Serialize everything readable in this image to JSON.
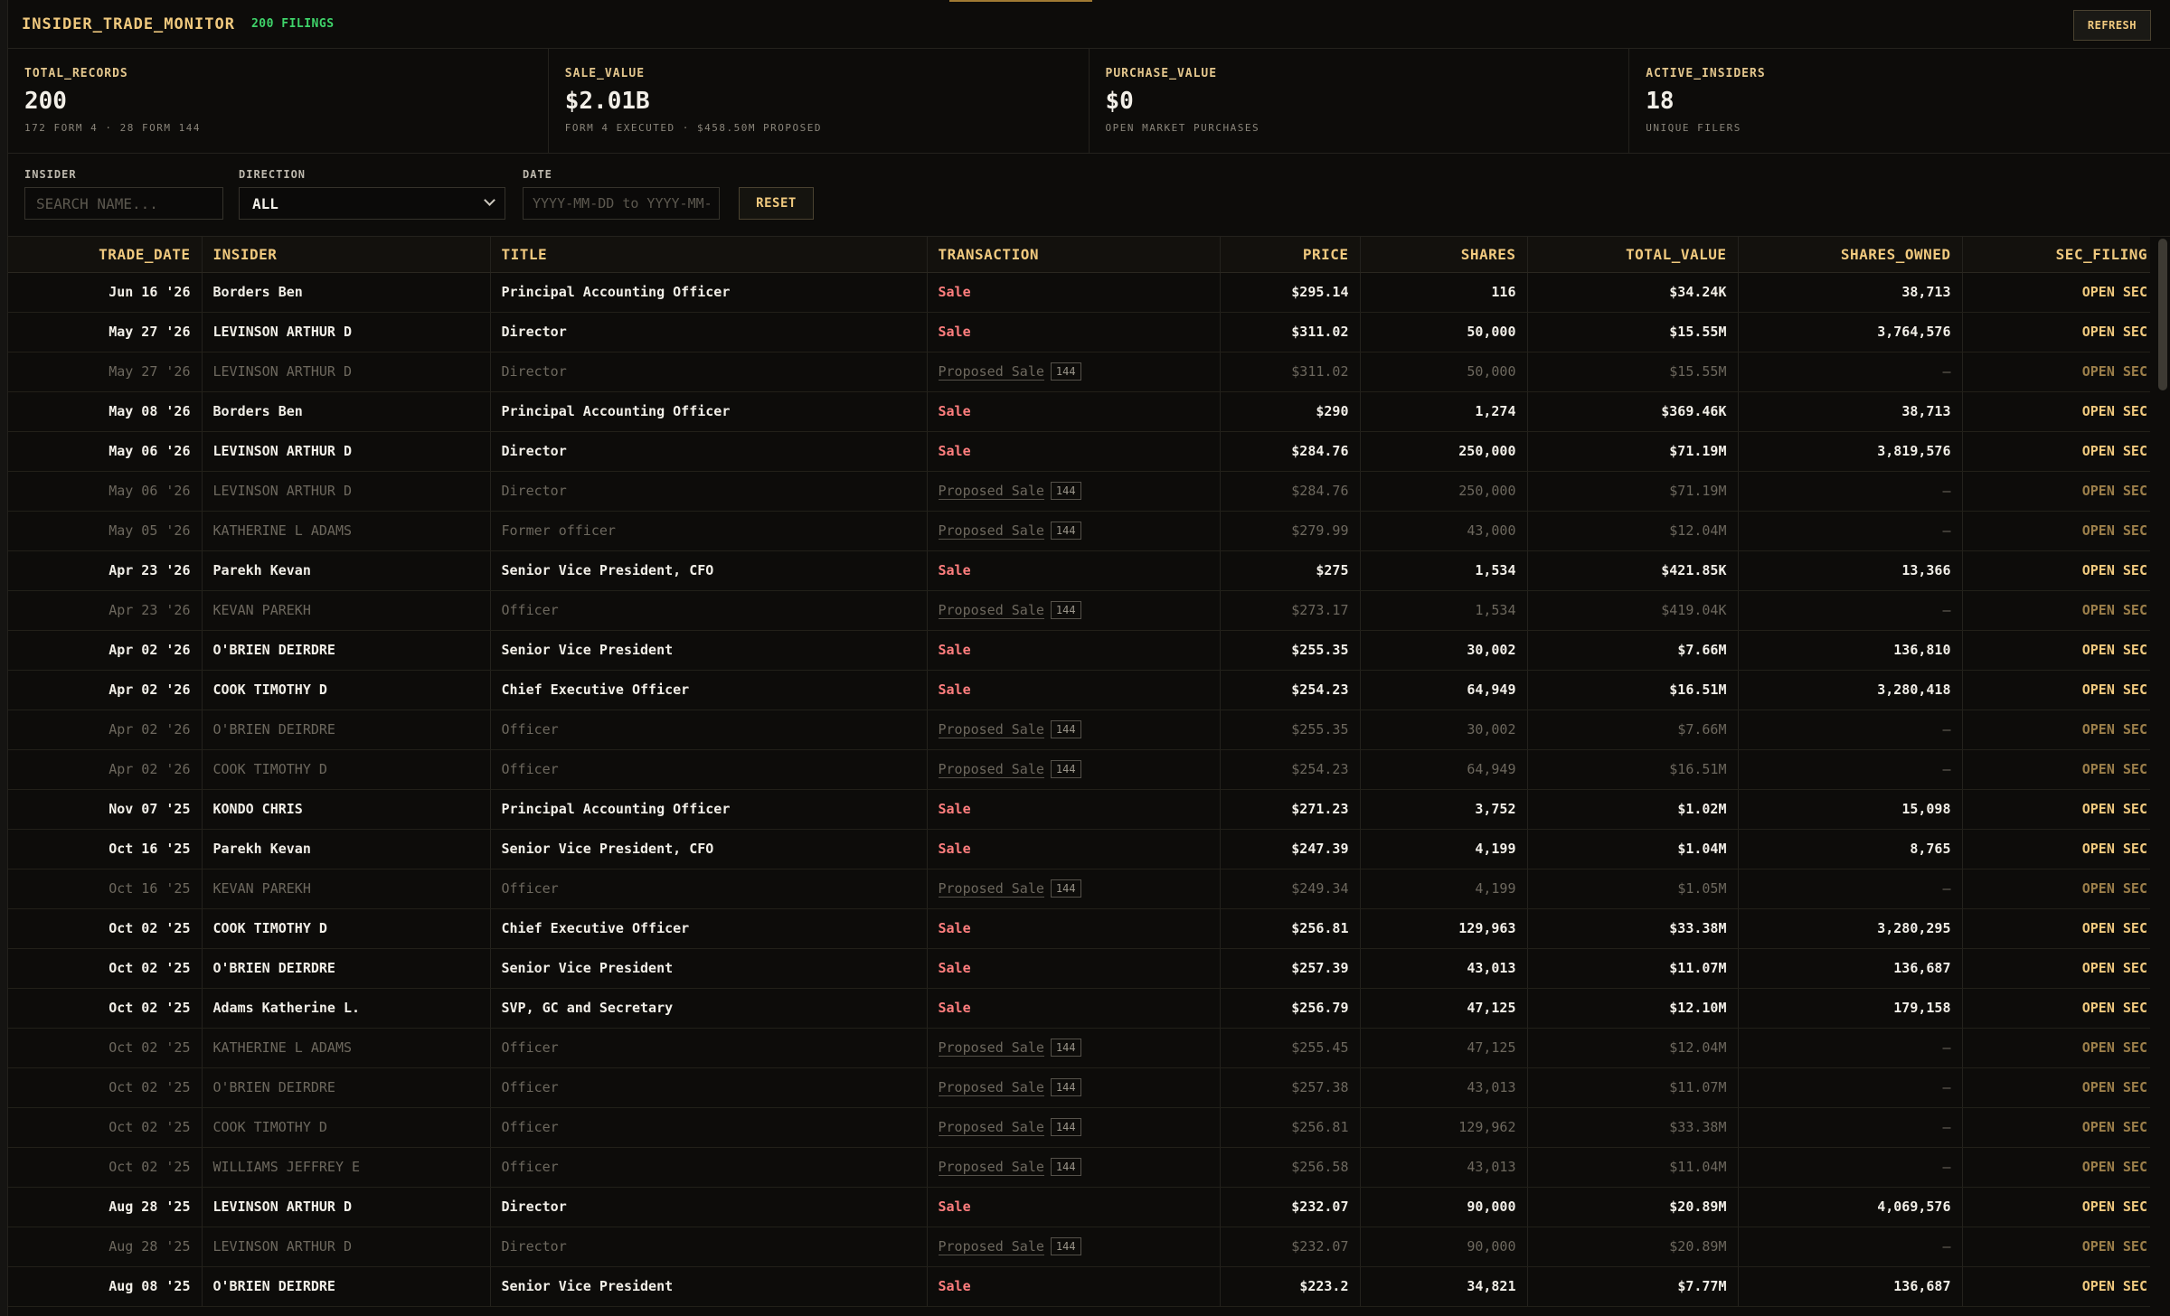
{
  "header": {
    "title": "INSIDER_TRADE_MONITOR",
    "filings_badge": "200 FILINGS",
    "refresh_label": "REFRESH"
  },
  "stats": [
    {
      "label": "TOTAL_RECORDS",
      "value": "200",
      "sub": "172 FORM 4 · 28 FORM 144"
    },
    {
      "label": "SALE_VALUE",
      "value": "$2.01B",
      "sub": "FORM 4 EXECUTED · $458.50M PROPOSED"
    },
    {
      "label": "PURCHASE_VALUE",
      "value": "$0",
      "sub": "OPEN MARKET PURCHASES"
    },
    {
      "label": "ACTIVE_INSIDERS",
      "value": "18",
      "sub": "UNIQUE FILERS"
    }
  ],
  "filters": {
    "insider_label": "INSIDER",
    "insider_placeholder": "SEARCH NAME...",
    "direction_label": "DIRECTION",
    "direction_value": "ALL",
    "date_label": "DATE",
    "date_placeholder": "YYYY-MM-DD to YYYY-MM-DD",
    "reset_label": "RESET"
  },
  "table": {
    "columns": [
      "TRADE_DATE",
      "INSIDER",
      "TITLE",
      "TRANSACTION",
      "PRICE",
      "SHARES",
      "TOTAL_VALUE",
      "SHARES_OWNED",
      "SEC_FILING"
    ],
    "link_label": "OPEN SEC",
    "form_badge": "144",
    "rows": [
      {
        "date": "Jun 16 '26",
        "insider": "Borders Ben",
        "title": "Principal Accounting Officer",
        "tx": "Sale",
        "proposed": false,
        "price": "$295.14",
        "shares": "116",
        "total": "$34.24K",
        "owned": "38,713"
      },
      {
        "date": "May 27 '26",
        "insider": "LEVINSON ARTHUR D",
        "title": "Director",
        "tx": "Sale",
        "proposed": false,
        "price": "$311.02",
        "shares": "50,000",
        "total": "$15.55M",
        "owned": "3,764,576"
      },
      {
        "date": "May 27 '26",
        "insider": "LEVINSON ARTHUR D",
        "title": "Director",
        "tx": "Proposed Sale",
        "proposed": true,
        "price": "$311.02",
        "shares": "50,000",
        "total": "$15.55M",
        "owned": "—"
      },
      {
        "date": "May 08 '26",
        "insider": "Borders Ben",
        "title": "Principal Accounting Officer",
        "tx": "Sale",
        "proposed": false,
        "price": "$290",
        "shares": "1,274",
        "total": "$369.46K",
        "owned": "38,713"
      },
      {
        "date": "May 06 '26",
        "insider": "LEVINSON ARTHUR D",
        "title": "Director",
        "tx": "Sale",
        "proposed": false,
        "price": "$284.76",
        "shares": "250,000",
        "total": "$71.19M",
        "owned": "3,819,576"
      },
      {
        "date": "May 06 '26",
        "insider": "LEVINSON ARTHUR D",
        "title": "Director",
        "tx": "Proposed Sale",
        "proposed": true,
        "price": "$284.76",
        "shares": "250,000",
        "total": "$71.19M",
        "owned": "—"
      },
      {
        "date": "May 05 '26",
        "insider": "KATHERINE L ADAMS",
        "title": "Former officer",
        "tx": "Proposed Sale",
        "proposed": true,
        "price": "$279.99",
        "shares": "43,000",
        "total": "$12.04M",
        "owned": "—"
      },
      {
        "date": "Apr 23 '26",
        "insider": "Parekh Kevan",
        "title": "Senior Vice President, CFO",
        "tx": "Sale",
        "proposed": false,
        "price": "$275",
        "shares": "1,534",
        "total": "$421.85K",
        "owned": "13,366"
      },
      {
        "date": "Apr 23 '26",
        "insider": "KEVAN PAREKH",
        "title": "Officer",
        "tx": "Proposed Sale",
        "proposed": true,
        "price": "$273.17",
        "shares": "1,534",
        "total": "$419.04K",
        "owned": "—"
      },
      {
        "date": "Apr 02 '26",
        "insider": "O'BRIEN DEIRDRE",
        "title": "Senior Vice President",
        "tx": "Sale",
        "proposed": false,
        "price": "$255.35",
        "shares": "30,002",
        "total": "$7.66M",
        "owned": "136,810"
      },
      {
        "date": "Apr 02 '26",
        "insider": "COOK TIMOTHY D",
        "title": "Chief Executive Officer",
        "tx": "Sale",
        "proposed": false,
        "price": "$254.23",
        "shares": "64,949",
        "total": "$16.51M",
        "owned": "3,280,418"
      },
      {
        "date": "Apr 02 '26",
        "insider": "O'BRIEN DEIRDRE",
        "title": "Officer",
        "tx": "Proposed Sale",
        "proposed": true,
        "price": "$255.35",
        "shares": "30,002",
        "total": "$7.66M",
        "owned": "—"
      },
      {
        "date": "Apr 02 '26",
        "insider": "COOK TIMOTHY D",
        "title": "Officer",
        "tx": "Proposed Sale",
        "proposed": true,
        "price": "$254.23",
        "shares": "64,949",
        "total": "$16.51M",
        "owned": "—"
      },
      {
        "date": "Nov 07 '25",
        "insider": "KONDO CHRIS",
        "title": "Principal Accounting Officer",
        "tx": "Sale",
        "proposed": false,
        "price": "$271.23",
        "shares": "3,752",
        "total": "$1.02M",
        "owned": "15,098"
      },
      {
        "date": "Oct 16 '25",
        "insider": "Parekh Kevan",
        "title": "Senior Vice President, CFO",
        "tx": "Sale",
        "proposed": false,
        "price": "$247.39",
        "shares": "4,199",
        "total": "$1.04M",
        "owned": "8,765"
      },
      {
        "date": "Oct 16 '25",
        "insider": "KEVAN PAREKH",
        "title": "Officer",
        "tx": "Proposed Sale",
        "proposed": true,
        "price": "$249.34",
        "shares": "4,199",
        "total": "$1.05M",
        "owned": "—"
      },
      {
        "date": "Oct 02 '25",
        "insider": "COOK TIMOTHY D",
        "title": "Chief Executive Officer",
        "tx": "Sale",
        "proposed": false,
        "price": "$256.81",
        "shares": "129,963",
        "total": "$33.38M",
        "owned": "3,280,295"
      },
      {
        "date": "Oct 02 '25",
        "insider": "O'BRIEN DEIRDRE",
        "title": "Senior Vice President",
        "tx": "Sale",
        "proposed": false,
        "price": "$257.39",
        "shares": "43,013",
        "total": "$11.07M",
        "owned": "136,687"
      },
      {
        "date": "Oct 02 '25",
        "insider": "Adams Katherine L.",
        "title": "SVP, GC and Secretary",
        "tx": "Sale",
        "proposed": false,
        "price": "$256.79",
        "shares": "47,125",
        "total": "$12.10M",
        "owned": "179,158"
      },
      {
        "date": "Oct 02 '25",
        "insider": "KATHERINE L ADAMS",
        "title": "Officer",
        "tx": "Proposed Sale",
        "proposed": true,
        "price": "$255.45",
        "shares": "47,125",
        "total": "$12.04M",
        "owned": "—"
      },
      {
        "date": "Oct 02 '25",
        "insider": "O'BRIEN DEIRDRE",
        "title": "Officer",
        "tx": "Proposed Sale",
        "proposed": true,
        "price": "$257.38",
        "shares": "43,013",
        "total": "$11.07M",
        "owned": "—"
      },
      {
        "date": "Oct 02 '25",
        "insider": "COOK TIMOTHY D",
        "title": "Officer",
        "tx": "Proposed Sale",
        "proposed": true,
        "price": "$256.81",
        "shares": "129,962",
        "total": "$33.38M",
        "owned": "—"
      },
      {
        "date": "Oct 02 '25",
        "insider": "WILLIAMS JEFFREY E",
        "title": "Officer",
        "tx": "Proposed Sale",
        "proposed": true,
        "price": "$256.58",
        "shares": "43,013",
        "total": "$11.04M",
        "owned": "—"
      },
      {
        "date": "Aug 28 '25",
        "insider": "LEVINSON ARTHUR D",
        "title": "Director",
        "tx": "Sale",
        "proposed": false,
        "price": "$232.07",
        "shares": "90,000",
        "total": "$20.89M",
        "owned": "4,069,576"
      },
      {
        "date": "Aug 28 '25",
        "insider": "LEVINSON ARTHUR D",
        "title": "Director",
        "tx": "Proposed Sale",
        "proposed": true,
        "price": "$232.07",
        "shares": "90,000",
        "total": "$20.89M",
        "owned": "—"
      },
      {
        "date": "Aug 08 '25",
        "insider": "O'BRIEN DEIRDRE",
        "title": "Senior Vice President",
        "tx": "Sale",
        "proposed": false,
        "price": "$223.2",
        "shares": "34,821",
        "total": "$7.77M",
        "owned": "136,687"
      }
    ]
  }
}
